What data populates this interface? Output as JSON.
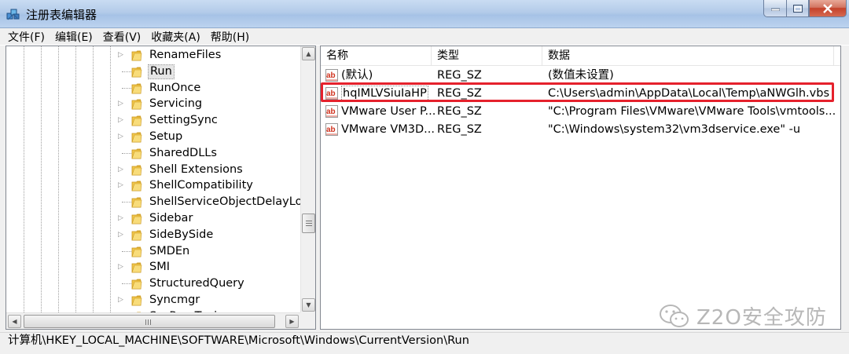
{
  "window": {
    "title": "注册表编辑器"
  },
  "menu": [
    "文件(F)",
    "编辑(E)",
    "查看(V)",
    "收藏夹(A)",
    "帮助(H)"
  ],
  "tree": {
    "items": [
      {
        "label": "RenameFiles",
        "expandable": true,
        "selected": false
      },
      {
        "label": "Run",
        "expandable": false,
        "selected": true
      },
      {
        "label": "RunOnce",
        "expandable": false,
        "selected": false
      },
      {
        "label": "Servicing",
        "expandable": true,
        "selected": false
      },
      {
        "label": "SettingSync",
        "expandable": true,
        "selected": false
      },
      {
        "label": "Setup",
        "expandable": true,
        "selected": false
      },
      {
        "label": "SharedDLLs",
        "expandable": false,
        "selected": false
      },
      {
        "label": "Shell Extensions",
        "expandable": true,
        "selected": false
      },
      {
        "label": "ShellCompatibility",
        "expandable": true,
        "selected": false
      },
      {
        "label": "ShellServiceObjectDelayLoad",
        "expandable": false,
        "selected": false
      },
      {
        "label": "Sidebar",
        "expandable": true,
        "selected": false
      },
      {
        "label": "SideBySide",
        "expandable": true,
        "selected": false
      },
      {
        "label": "SMDEn",
        "expandable": false,
        "selected": false
      },
      {
        "label": "SMI",
        "expandable": true,
        "selected": false
      },
      {
        "label": "StructuredQuery",
        "expandable": false,
        "selected": false
      },
      {
        "label": "Syncmgr",
        "expandable": true,
        "selected": false
      },
      {
        "label": "SysPrepTapi",
        "expandable": true,
        "selected": false
      }
    ]
  },
  "list": {
    "columns": [
      "名称",
      "类型",
      "数据"
    ],
    "rows": [
      {
        "name": "(默认)",
        "type": "REG_SZ",
        "data": "(数值未设置)"
      },
      {
        "name": "hqIMLVSiuIaHP",
        "type": "REG_SZ",
        "data": "C:\\Users\\admin\\AppData\\Local\\Temp\\aNWGlh.vbs"
      },
      {
        "name": "VMware User P...",
        "type": "REG_SZ",
        "data": "\"C:\\Program Files\\VMware\\VMware Tools\\vmtools..."
      },
      {
        "name": "VMware VM3D...",
        "type": "REG_SZ",
        "data": "\"C:\\Windows\\system32\\vm3dservice.exe\" -u"
      }
    ]
  },
  "statusbar": {
    "path": "计算机\\HKEY_LOCAL_MACHINE\\SOFTWARE\\Microsoft\\Windows\\CurrentVersion\\Run"
  },
  "watermark": {
    "text": "Z2O安全攻防"
  },
  "colors": {
    "highlight": "#e5212c",
    "titlebar": "#b3cbe9",
    "folder": "#f2c94c"
  },
  "icons": {
    "value": "string-value-icon",
    "folder": "folder-icon",
    "app": "registry-editor-icon"
  }
}
